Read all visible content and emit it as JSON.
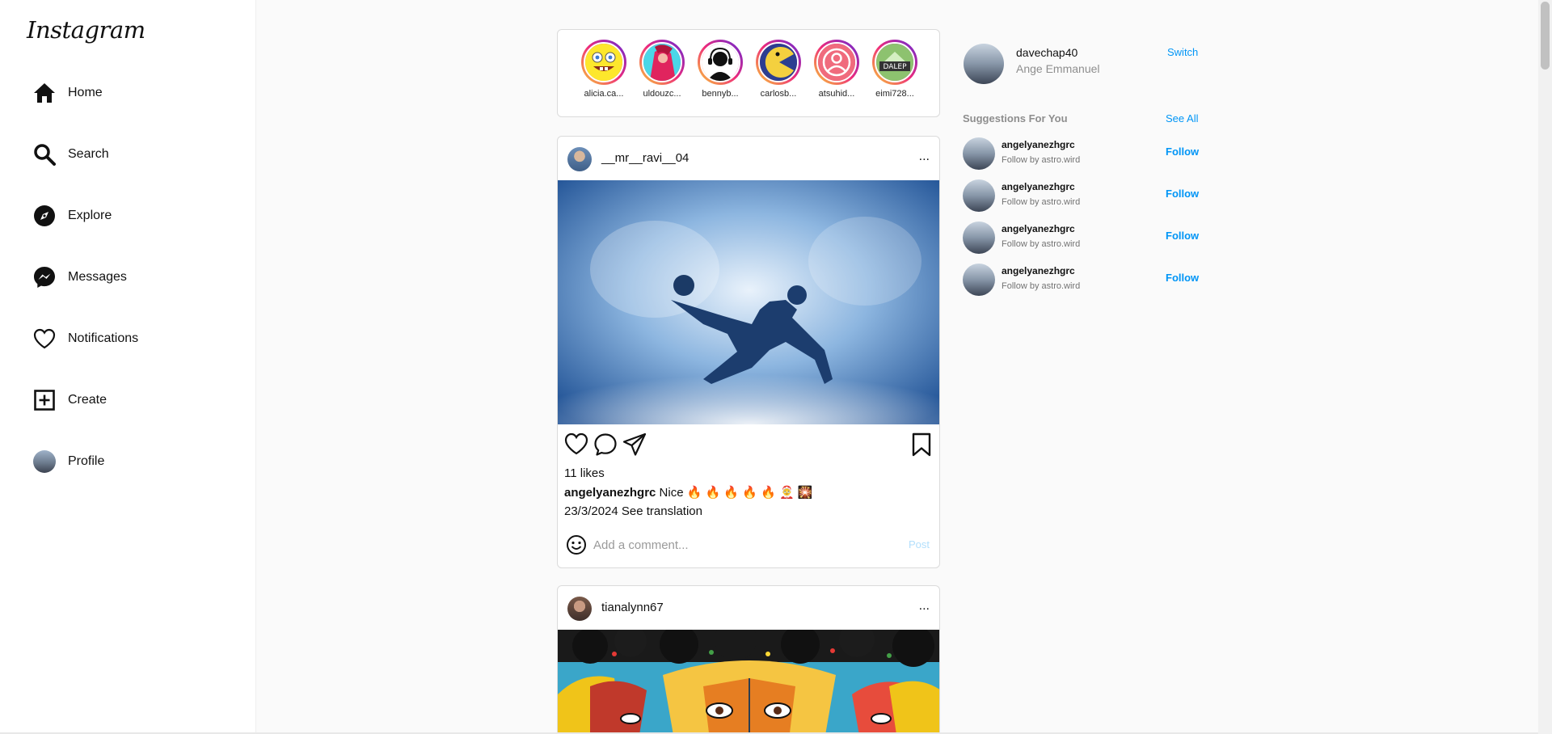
{
  "app": {
    "logo": "Instagram"
  },
  "sidebar": {
    "items": [
      {
        "label": "Home",
        "icon": "home-icon"
      },
      {
        "label": "Search",
        "icon": "search-icon"
      },
      {
        "label": "Explore",
        "icon": "compass-icon"
      },
      {
        "label": "Messages",
        "icon": "messenger-icon"
      },
      {
        "label": "Notifications",
        "icon": "heart-icon"
      },
      {
        "label": "Create",
        "icon": "plus-square-icon"
      },
      {
        "label": "Profile",
        "icon": "avatar"
      }
    ]
  },
  "stories": [
    {
      "name": "alicia.ca..."
    },
    {
      "name": "uldouzc..."
    },
    {
      "name": "bennyb..."
    },
    {
      "name": "carlosb..."
    },
    {
      "name": "atsuhid..."
    },
    {
      "name": "eimi728..."
    }
  ],
  "posts": [
    {
      "username": "__mr__ravi__04",
      "more": "...",
      "likes": "11 likes",
      "caption_user": "angelyanezhgrc",
      "caption_text": "Nice 🔥 🔥 🔥 🔥 🔥 🤶 🎇",
      "date": "23/3/2024",
      "see_translation": "See translation",
      "comment_placeholder": "Add a comment...",
      "post_label": "Post"
    },
    {
      "username": "tianalynn67",
      "more": "..."
    }
  ],
  "me": {
    "username": "davechap40",
    "fullname": "Ange Emmanuel",
    "switch_label": "Switch"
  },
  "suggestions": {
    "title": "Suggestions For You",
    "see_all": "See All",
    "items": [
      {
        "name": "angelyanezhgrc",
        "sub": "Follow by astro.wird",
        "action": "Follow"
      },
      {
        "name": "angelyanezhgrc",
        "sub": "Follow by astro.wird",
        "action": "Follow"
      },
      {
        "name": "angelyanezhgrc",
        "sub": "Follow by astro.wird",
        "action": "Follow"
      },
      {
        "name": "angelyanezhgrc",
        "sub": "Follow by astro.wird",
        "action": "Follow"
      }
    ]
  },
  "colors": {
    "link": "#0095f6",
    "border": "#dbdbdb",
    "background": "#fafafa"
  }
}
